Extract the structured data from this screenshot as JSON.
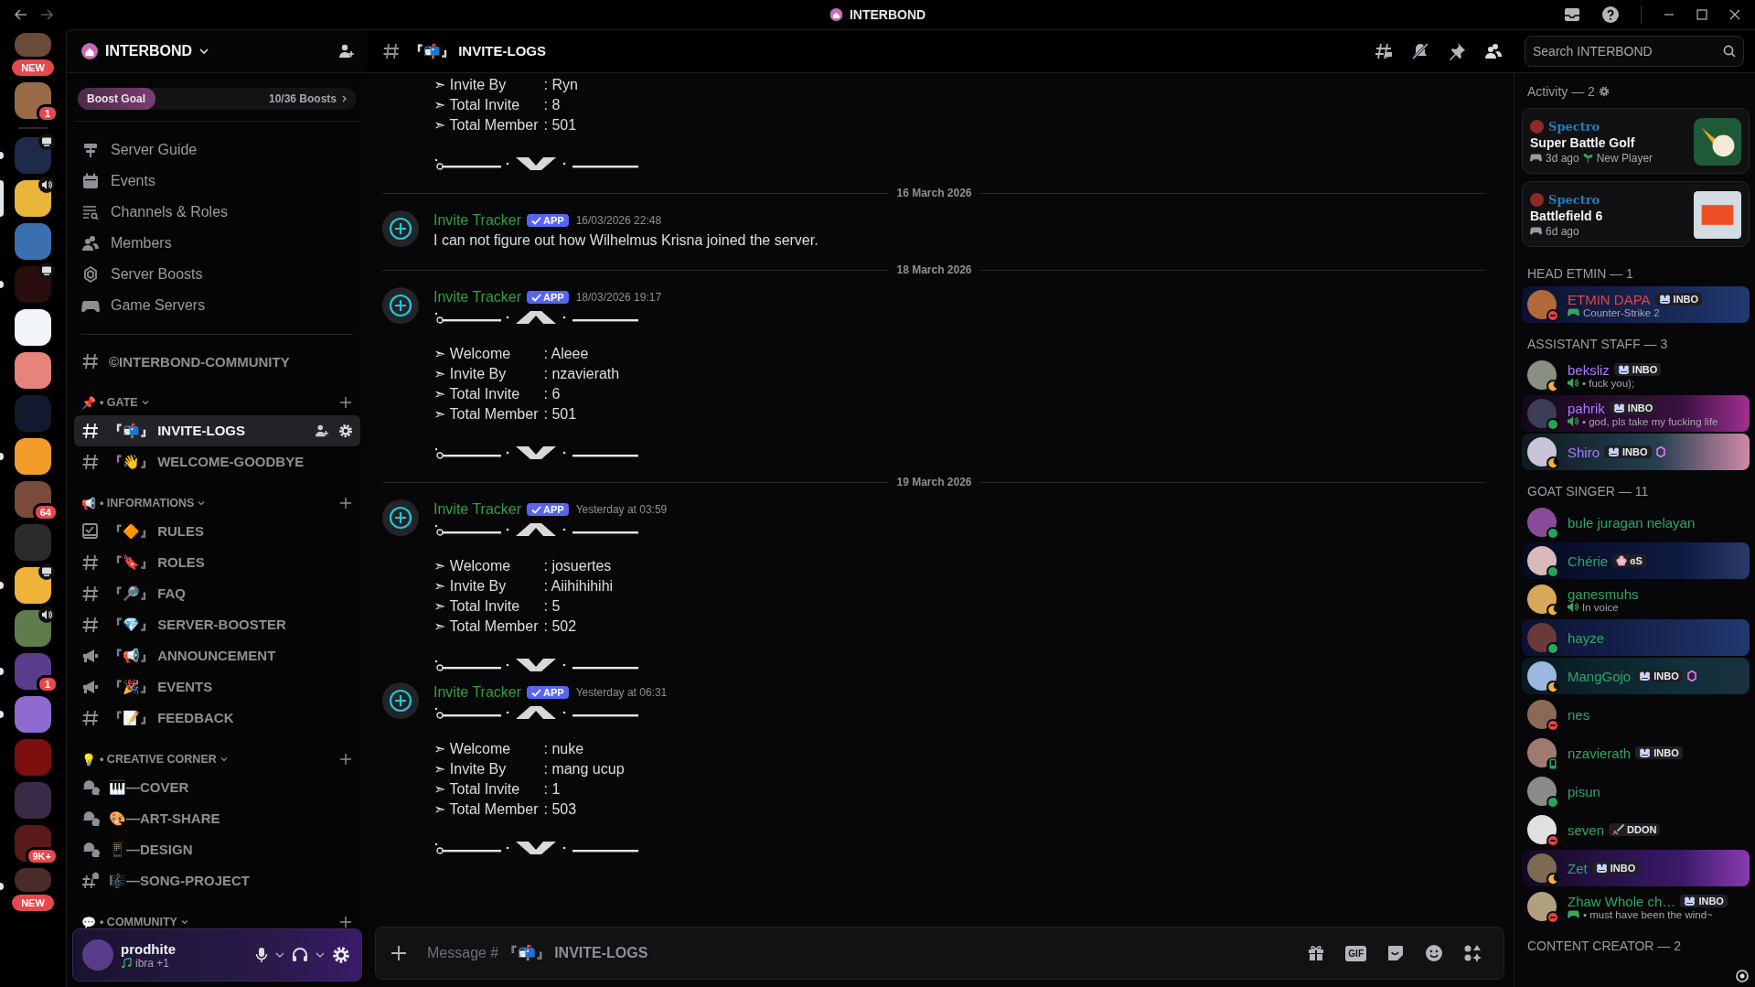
{
  "titlebar": {
    "title": "INTERBOND"
  },
  "servers": [
    {
      "kind": "server",
      "badge": {
        "kind": "pill",
        "text": "NEW"
      },
      "screen_sharing": false,
      "in_voice": false,
      "selected": false,
      "unread": false
    },
    {
      "kind": "server",
      "badge": {
        "kind": "count",
        "text": "1"
      },
      "screen_sharing": false,
      "in_voice": false,
      "selected": false,
      "unread": false
    },
    {
      "kind": "separator"
    },
    {
      "kind": "server",
      "screen_sharing": true,
      "in_voice": false,
      "selected": false,
      "unread": true
    },
    {
      "kind": "server",
      "screen_sharing": false,
      "in_voice": true,
      "selected": true,
      "unread": false
    },
    {
      "kind": "server",
      "screen_sharing": false,
      "in_voice": false,
      "selected": false,
      "unread": false
    },
    {
      "kind": "server",
      "screen_sharing": true,
      "in_voice": false,
      "selected": false,
      "unread": true
    },
    {
      "kind": "server",
      "screen_sharing": false,
      "in_voice": false,
      "selected": false,
      "unread": false
    },
    {
      "kind": "server",
      "screen_sharing": false,
      "in_voice": false,
      "selected": false,
      "unread": false
    },
    {
      "kind": "server",
      "screen_sharing": false,
      "in_voice": false,
      "selected": false,
      "unread": false
    },
    {
      "kind": "server",
      "screen_sharing": false,
      "in_voice": false,
      "selected": false,
      "unread": true
    },
    {
      "kind": "server",
      "badge": {
        "kind": "count",
        "text": "64"
      },
      "screen_sharing": false,
      "in_voice": false,
      "selected": false,
      "unread": false
    },
    {
      "kind": "server",
      "screen_sharing": false,
      "in_voice": false,
      "selected": false,
      "unread": false
    },
    {
      "kind": "server",
      "screen_sharing": true,
      "in_voice": false,
      "selected": false,
      "unread": true
    },
    {
      "kind": "server",
      "screen_sharing": false,
      "in_voice": true,
      "selected": false,
      "unread": false
    },
    {
      "kind": "server",
      "badge": {
        "kind": "count",
        "text": "1"
      },
      "screen_sharing": false,
      "in_voice": false,
      "selected": false,
      "unread": true
    },
    {
      "kind": "server",
      "screen_sharing": false,
      "in_voice": false,
      "selected": false,
      "unread": true
    },
    {
      "kind": "server",
      "screen_sharing": false,
      "in_voice": false,
      "selected": false,
      "unread": false
    },
    {
      "kind": "server",
      "screen_sharing": false,
      "in_voice": false,
      "selected": false,
      "unread": false
    },
    {
      "kind": "server",
      "badge": {
        "kind": "count",
        "text": "9K+"
      },
      "screen_sharing": false,
      "in_voice": false,
      "selected": false,
      "unread": false
    },
    {
      "kind": "server",
      "badge": {
        "kind": "pill",
        "text": "NEW"
      },
      "screen_sharing": false,
      "in_voice": false,
      "selected": false,
      "unread": true
    }
  ],
  "server": {
    "name": "INTERBOND"
  },
  "boost": {
    "label": "Boost Goal",
    "count": "10/36 Boosts",
    "level": 0.28
  },
  "guide_items": [
    {
      "kind": "guide",
      "label": "Server Guide"
    },
    {
      "kind": "events",
      "label": "Events"
    },
    {
      "kind": "browse",
      "label": "Channels & Roles"
    },
    {
      "kind": "members",
      "label": "Members"
    },
    {
      "kind": "boosts",
      "label": "Server Boosts"
    },
    {
      "kind": "game",
      "label": "Game Servers"
    }
  ],
  "top_channel": {
    "kind": "text",
    "name": "©INTERBOND-COMMUNITY"
  },
  "categories": [
    {
      "emoji": "📌",
      "name": "• GATE",
      "channels": [
        {
          "kind": "text",
          "name": "『📬』 INVITE-LOGS",
          "selected": true
        },
        {
          "kind": "text",
          "name": "『👋』 WELCOME-GOODBYE",
          "selected": false
        }
      ]
    },
    {
      "emoji": "📢",
      "name": "• INFORMATIONS",
      "channels": [
        {
          "kind": "rules",
          "name": "『🔶』 RULES",
          "selected": false
        },
        {
          "kind": "text",
          "name": "『🔖』 ROLES",
          "selected": false
        },
        {
          "kind": "text",
          "name": "『🔎』 FAQ",
          "selected": false
        },
        {
          "kind": "text",
          "name": "『💎』 SERVER-BOOSTER",
          "selected": false
        },
        {
          "kind": "announcement",
          "name": "『📢』 ANNOUNCEMENT",
          "selected": false
        },
        {
          "kind": "announcement",
          "name": "『🎉』 EVENTS",
          "selected": false
        },
        {
          "kind": "text",
          "name": "『📝』 FEEDBACK",
          "selected": false
        }
      ]
    },
    {
      "emoji": "💡",
      "name": "• CREATIVE CORNER",
      "channels": [
        {
          "kind": "forum",
          "name": "🎹—COVER",
          "selected": false
        },
        {
          "kind": "forum",
          "name": "🎨—ART-SHARE",
          "selected": false
        },
        {
          "kind": "forum",
          "name": "📱—DESIGN",
          "selected": false
        },
        {
          "kind": "locked",
          "name": "🎼—SONG-PROJECT",
          "selected": false
        }
      ]
    },
    {
      "emoji": "💬",
      "name": "• COMMUNITY"
    }
  ],
  "user": {
    "name": "prodhite",
    "status": "ibra +1"
  },
  "channel_header": {
    "name": "『📬』 INVITE-LOGS",
    "search_placeholder": "Search INTERBOND"
  },
  "messages": [
    {
      "kind": "continuation",
      "blocks": [
        {
          "kind": "fields",
          "lines": [
            {
              "label": "➣ Invite By",
              "value": ": Ryn"
            },
            {
              "label": "➣ Total Invite",
              "value": ": 8"
            },
            {
              "label": "➣ Total Member",
              "value": ": 501"
            }
          ]
        },
        {
          "kind": "closer"
        }
      ]
    },
    {
      "kind": "date",
      "text": "16 March 2026"
    },
    {
      "kind": "message",
      "author": "Invite Tracker",
      "tag": "APP",
      "time": "16/03/2026 22:48",
      "blocks": [
        {
          "kind": "text",
          "text": "I can not figure out how Wilhelmus Krisna joined the server."
        }
      ]
    },
    {
      "kind": "date",
      "text": "18 March 2026"
    },
    {
      "kind": "message",
      "author": "Invite Tracker",
      "tag": "APP",
      "time": "18/03/2026 19:17",
      "blocks": [
        {
          "kind": "opener"
        },
        {
          "kind": "fields",
          "lines": [
            {
              "label": "➣ Welcome",
              "value": ": Aleee"
            },
            {
              "label": "➣ Invite By",
              "value": ": nzavierath"
            },
            {
              "label": "➣ Total Invite",
              "value": ": 6"
            },
            {
              "label": "➣ Total Member",
              "value": ": 501"
            }
          ]
        },
        {
          "kind": "closer"
        }
      ]
    },
    {
      "kind": "date",
      "text": "19 March 2026"
    },
    {
      "kind": "message",
      "author": "Invite Tracker",
      "tag": "APP",
      "time": "Yesterday at 03:59",
      "blocks": [
        {
          "kind": "opener"
        },
        {
          "kind": "fields",
          "lines": [
            {
              "label": "➣ Welcome",
              "value": ": josuertes"
            },
            {
              "label": "➣ Invite By",
              "value": ": Aiihihihihi"
            },
            {
              "label": "➣ Total Invite",
              "value": ": 5"
            },
            {
              "label": "➣ Total Member",
              "value": ": 502"
            }
          ]
        },
        {
          "kind": "closer"
        }
      ]
    },
    {
      "kind": "message",
      "author": "Invite Tracker",
      "tag": "APP",
      "time": "Yesterday at 06:31",
      "blocks": [
        {
          "kind": "opener"
        },
        {
          "kind": "fields",
          "lines": [
            {
              "label": "➣ Welcome",
              "value": ": nuke"
            },
            {
              "label": "➣ Invite By",
              "value": ": mang ucup"
            },
            {
              "label": "➣ Total Invite",
              "value": ": 1"
            },
            {
              "label": "➣ Total Member",
              "value": ": 503"
            }
          ]
        },
        {
          "kind": "closer"
        }
      ]
    }
  ],
  "composer": {
    "placeholder": "Message # **『📬』 INVITE-LOGS**",
    "gif": "GIF"
  },
  "activity": {
    "title": "Activity — 2",
    "items": [
      {
        "kind": "golf",
        "user": "Spectro",
        "game": "Super Battle Golf",
        "time": "3d ago",
        "badge": "New Player"
      },
      {
        "kind": "shooter",
        "user": "Spectro",
        "game": "Battlefield 6",
        "time": "6d ago"
      }
    ]
  },
  "member_groups": [
    {
      "title": "HEAD ETMIN — 1",
      "members": [
        {
          "kind": "dnd",
          "name": "ETMIN DAPA",
          "color": "#e5443e",
          "tag": {
            "kind": "frog",
            "text": "INBO"
          },
          "activity": {
            "kind": "game",
            "text": "Counter-Strike 2"
          },
          "banner": true,
          "boosting": false
        }
      ]
    },
    {
      "title": "ASSISTANT STAFF — 3",
      "members": [
        {
          "kind": "idle",
          "name": "beksliz",
          "color": "#a97bff",
          "tag": {
            "kind": "frog",
            "text": "INBO"
          },
          "activity": {
            "kind": "voice",
            "text": "• fuck you);"
          },
          "banner": false,
          "boosting": false
        },
        {
          "kind": "online",
          "name": "pahrik",
          "color": "#a97bff",
          "tag": {
            "kind": "frog",
            "text": "INBO"
          },
          "activity": {
            "kind": "voice",
            "text": "• god, pls take my fucking life"
          },
          "banner": true,
          "boosting": false
        },
        {
          "kind": "idle",
          "name": "Shiro",
          "color": "#a97bff",
          "tag": {
            "kind": "frog",
            "text": "INBO"
          },
          "banner": true,
          "boosting": true
        }
      ]
    },
    {
      "title": "GOAT SINGER — 11",
      "members": [
        {
          "kind": "online",
          "name": "bule juragan nelayan",
          "color": "#2ea66a",
          "banner": false,
          "boosting": false
        },
        {
          "kind": "online",
          "name": "Chérie",
          "color": "#2ea66a",
          "tag": {
            "kind": "flower",
            "text": "ɞS"
          },
          "banner": true,
          "boosting": false
        },
        {
          "kind": "idle",
          "name": "ganesmuhs",
          "color": "#2ea66a",
          "activity": {
            "kind": "voice",
            "text": "In voice"
          },
          "banner": false,
          "boosting": false
        },
        {
          "kind": "online",
          "name": "hayze",
          "color": "#2ea66a",
          "banner": true,
          "boosting": false
        },
        {
          "kind": "idle",
          "name": "MangGojo",
          "color": "#2ea66a",
          "tag": {
            "kind": "frog",
            "text": "INBO"
          },
          "banner": true,
          "boosting": true
        },
        {
          "kind": "dnd",
          "name": "nes",
          "color": "#2ea66a",
          "banner": false,
          "boosting": false
        },
        {
          "kind": "mobile",
          "name": "nzavierath",
          "color": "#2ea66a",
          "tag": {
            "kind": "frog",
            "text": "INBO"
          },
          "banner": false,
          "boosting": false
        },
        {
          "kind": "online",
          "name": "pisun",
          "color": "#2ea66a",
          "banner": false,
          "boosting": false
        },
        {
          "kind": "dnd",
          "name": "seven",
          "color": "#2ea66a",
          "tag": {
            "kind": "sword",
            "text": "DDON"
          },
          "banner": false,
          "boosting": false
        },
        {
          "kind": "idle",
          "name": "Zet",
          "color": "#2ea66a",
          "tag": {
            "kind": "frog",
            "text": "INBO"
          },
          "banner": true,
          "boosting": false
        },
        {
          "kind": "dnd",
          "name": "Zhaw Whole ch…",
          "color": "#2ea66a",
          "tag": {
            "kind": "frog",
            "text": "INBO"
          },
          "activity": {
            "kind": "game",
            "text": "• must have been the wind~"
          },
          "banner": false,
          "boosting": false
        }
      ]
    },
    {
      "title": "CONTENT CREATOR — 2"
    }
  ]
}
